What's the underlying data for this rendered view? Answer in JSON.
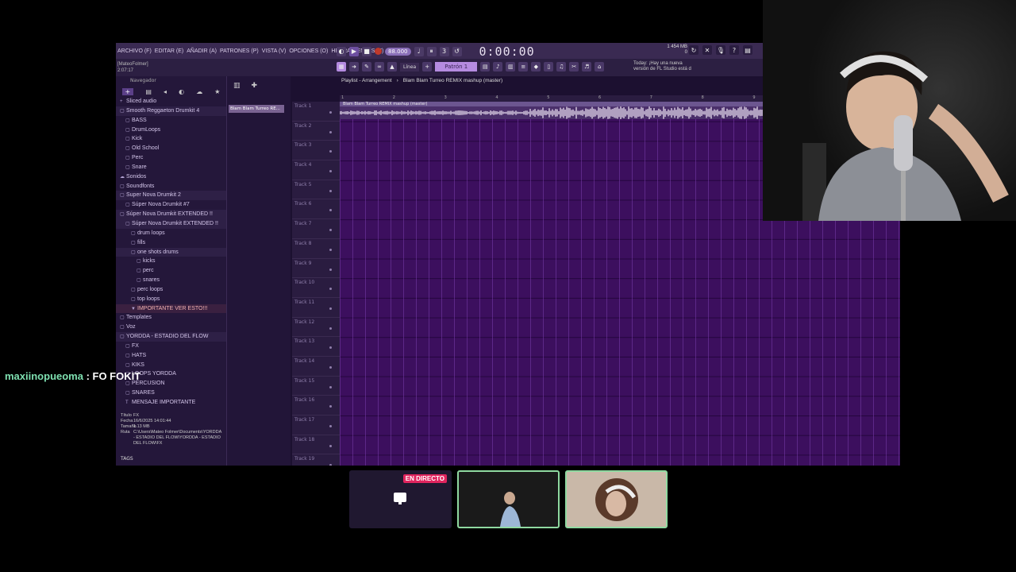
{
  "fl": {
    "menus": [
      "ARCHIVO (F)",
      "EDITAR (E)",
      "AÑADIR (A)",
      "PATRONES (P)",
      "VISTA (V)",
      "OPCIONES (O)",
      "HERRAMIENTAS (T)",
      "AYUDA"
    ],
    "tempo": "88.000",
    "time": "0:00:00",
    "cpu_line1": "1    454 MB",
    "cpu_line2": "0",
    "hint_line1": "[MateoFolmer]",
    "hint_line2": "2:07:17",
    "snap": "Línea",
    "pattern": "Patrón 1",
    "news_line1": "Today: ¡Hay una nueva",
    "news_line2": "versión de FL Studio está d"
  },
  "browser": {
    "header": "Navegador",
    "tree": [
      {
        "label": "Sliced audio",
        "depth": 0,
        "icon": "+"
      },
      {
        "label": "Smooth Reggaeton Drumkit 4",
        "depth": 0,
        "icon": "▢",
        "open": true
      },
      {
        "label": "BASS",
        "depth": 1,
        "icon": "▢"
      },
      {
        "label": "DrumLoops",
        "depth": 1,
        "icon": "▢"
      },
      {
        "label": "Kick",
        "depth": 1,
        "icon": "▢"
      },
      {
        "label": "Old School",
        "depth": 1,
        "icon": "▢"
      },
      {
        "label": "Perc",
        "depth": 1,
        "icon": "▢"
      },
      {
        "label": "Snare",
        "depth": 1,
        "icon": "▢"
      },
      {
        "label": "Sonidos",
        "depth": 0,
        "icon": "☁"
      },
      {
        "label": "Soundfonts",
        "depth": 0,
        "icon": "▢"
      },
      {
        "label": "Super Nova Drumkit 2",
        "depth": 0,
        "icon": "▢",
        "open": true
      },
      {
        "label": "Súper Nova Drumkit #7",
        "depth": 1,
        "icon": "▢"
      },
      {
        "label": "Súper Nova Drumkit EXTENDED !!",
        "depth": 0,
        "icon": "▢",
        "open": true
      },
      {
        "label": "Súper Nova Drumkit EXTENDED !!",
        "depth": 1,
        "icon": "▢",
        "open": true
      },
      {
        "label": "drum loops",
        "depth": 2,
        "icon": "▢"
      },
      {
        "label": "fills",
        "depth": 2,
        "icon": "▢"
      },
      {
        "label": "one shots drums",
        "depth": 2,
        "icon": "▢",
        "open": true
      },
      {
        "label": "kicks",
        "depth": 3,
        "icon": "▢"
      },
      {
        "label": "perc",
        "depth": 3,
        "icon": "▢"
      },
      {
        "label": "snares",
        "depth": 3,
        "icon": "▢"
      },
      {
        "label": "perc loops",
        "depth": 2,
        "icon": "▢"
      },
      {
        "label": "top loops",
        "depth": 2,
        "icon": "▢"
      },
      {
        "label": "IMPORTANTE VER ESTO!!!",
        "depth": 2,
        "icon": "▼",
        "important": true
      },
      {
        "label": "Templates",
        "depth": 0,
        "icon": "▢"
      },
      {
        "label": "Voz",
        "depth": 0,
        "icon": "▢"
      },
      {
        "label": "YORDDA - ESTADIO DEL FLOW",
        "depth": 0,
        "icon": "▢",
        "open": true
      },
      {
        "label": "FX",
        "depth": 1,
        "icon": "▢"
      },
      {
        "label": "HATS",
        "depth": 1,
        "icon": "▢"
      },
      {
        "label": "KIKS",
        "depth": 1,
        "icon": "▢"
      },
      {
        "label": "LOOPS YORDDA",
        "depth": 1,
        "icon": "▢"
      },
      {
        "label": "PERCUSION",
        "depth": 1,
        "icon": "▢"
      },
      {
        "label": "SNARES",
        "depth": 1,
        "icon": "▢"
      },
      {
        "label": "MENSAJE IMPORTANTE",
        "depth": 1,
        "icon": "T"
      }
    ],
    "fileinfo": [
      {
        "key": "Título",
        "value": "FX"
      },
      {
        "key": "Fecha",
        "value": "16/6/2025 14:01:44"
      },
      {
        "key": "Tamaño",
        "value": "1.13 MB"
      },
      {
        "key": "Ruta",
        "value": "C:\\Users\\Mateo Folmer\\Documents\\YORDDA - ESTADIO DEL FLOW\\YORDDA - ESTADIO DEL FLOW\\FX"
      }
    ],
    "tags_label": "TAGS"
  },
  "playlist": {
    "title": "Playlist - Arrangement",
    "breadcrumb": "Blam Blam Turreo REMIX mashup (master)",
    "pattern_clip": "Blam Blam Turreo RE...",
    "clip_title": "Blam Blam Turreo REMIX mashup (master)",
    "ruler": [
      "1",
      "2",
      "3",
      "4",
      "5",
      "6",
      "7",
      "8",
      "9"
    ],
    "tracks": [
      "Track 1",
      "Track 2",
      "Track 3",
      "Track 4",
      "Track 5",
      "Track 6",
      "Track 7",
      "Track 8",
      "Track 9",
      "Track 10",
      "Track 11",
      "Track 12",
      "Track 13",
      "Track 14",
      "Track 15",
      "Track 16",
      "Track 17",
      "Track 18",
      "Track 19"
    ]
  },
  "chat": {
    "user": "maxiinopueoma",
    "message": " : FO FOKIT"
  },
  "stream": {
    "live_badge": "EN DIRECTO"
  }
}
